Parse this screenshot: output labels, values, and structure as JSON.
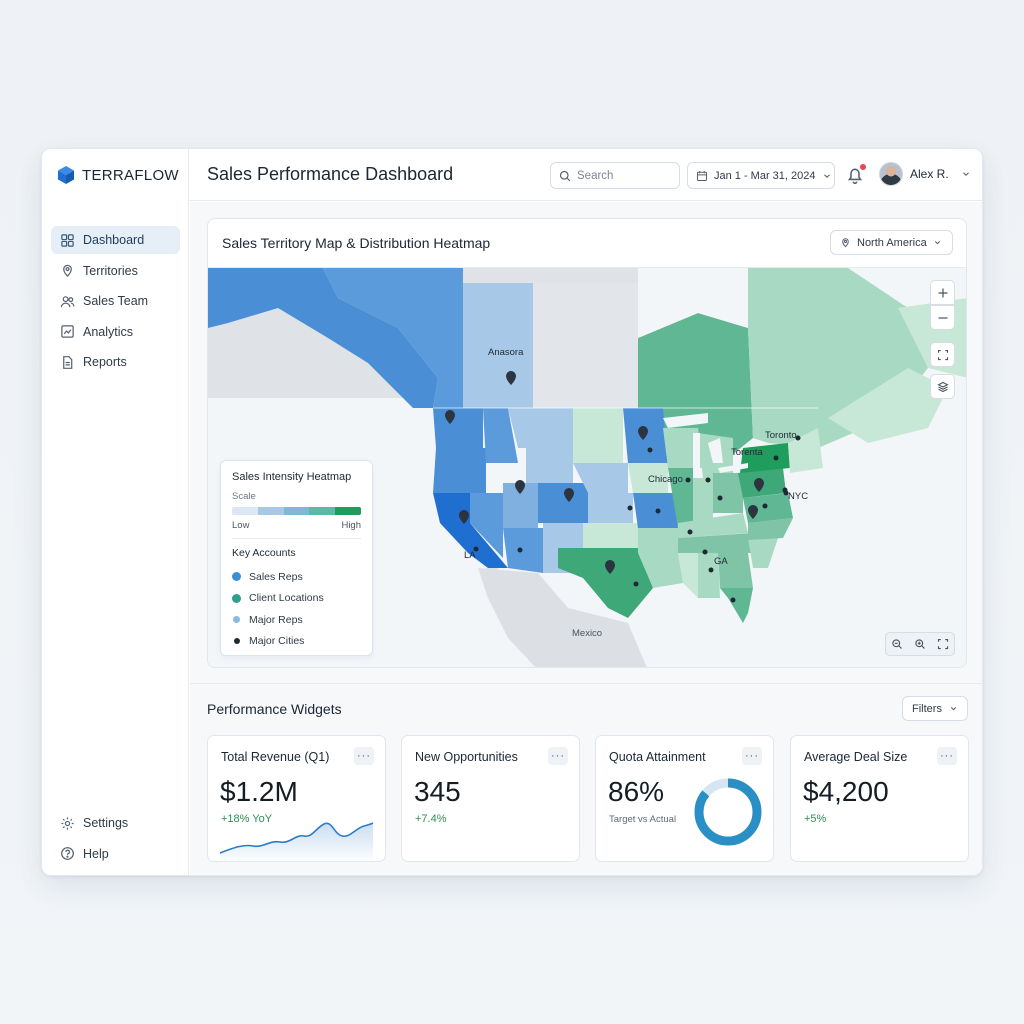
{
  "brand": {
    "name": "TERRAFLOW",
    "accent": "#1f6fd1"
  },
  "sidebar": {
    "items": [
      {
        "label": "Dashboard",
        "icon": "grid-icon",
        "active": true
      },
      {
        "label": "Territories",
        "icon": "map-pin-icon"
      },
      {
        "label": "Sales Team",
        "icon": "users-icon"
      },
      {
        "label": "Analytics",
        "icon": "chart-icon"
      },
      {
        "label": "Reports",
        "icon": "document-icon"
      }
    ],
    "bottom": [
      {
        "label": "Settings",
        "icon": "gear-icon"
      },
      {
        "label": "Help",
        "icon": "help-icon"
      }
    ]
  },
  "header": {
    "title": "Sales Performance Dashboard",
    "search_placeholder": "Search",
    "date_range": "Jan 1 - Mar 31, 2024",
    "user_name": "Alex R.",
    "notification_dot_color": "#e5484d"
  },
  "map": {
    "title": "Sales Territory Map & Distribution Heatmap",
    "region": "North America",
    "labels": {
      "anasora": "Anasora",
      "toronto": "Toronto",
      "toronta": "Torenta",
      "chicago": "Chicago",
      "nyc": "NYC",
      "la": "LA",
      "ga": "GA",
      "mexico": "Mexico"
    },
    "legend": {
      "title": "Sales Intensity Heatmap",
      "scale_label": "Scale",
      "low": "Low",
      "high": "High",
      "scale_colors": [
        "#dbe7f3",
        "#a9c8e6",
        "#7fb8d8",
        "#5fb8a3",
        "#1f9d5c"
      ],
      "key_title": "Key Accounts",
      "keys": [
        {
          "label": "Sales Reps",
          "color": "#3d8ed8"
        },
        {
          "label": "Client Locations",
          "color": "#2f9e8c"
        },
        {
          "label": "Major Reps",
          "color": "#8fb8e0"
        },
        {
          "label": "Major Cities",
          "color": "#1f2933"
        }
      ]
    }
  },
  "widgets": {
    "title": "Performance Widgets",
    "filters_label": "Filters",
    "cards": [
      {
        "title": "Total Revenue (Q1)",
        "value": "$1.2M",
        "delta": "+18% YoY"
      },
      {
        "title": "New Opportunities",
        "value": "345",
        "delta": "+7.4%"
      },
      {
        "title": "Quota Attainment",
        "value": "86%",
        "sub": "Target vs Actual",
        "progress": 0.86
      },
      {
        "title": "Average Deal Size",
        "value": "$4,200",
        "delta": "+5%"
      }
    ],
    "more_label": "···"
  }
}
